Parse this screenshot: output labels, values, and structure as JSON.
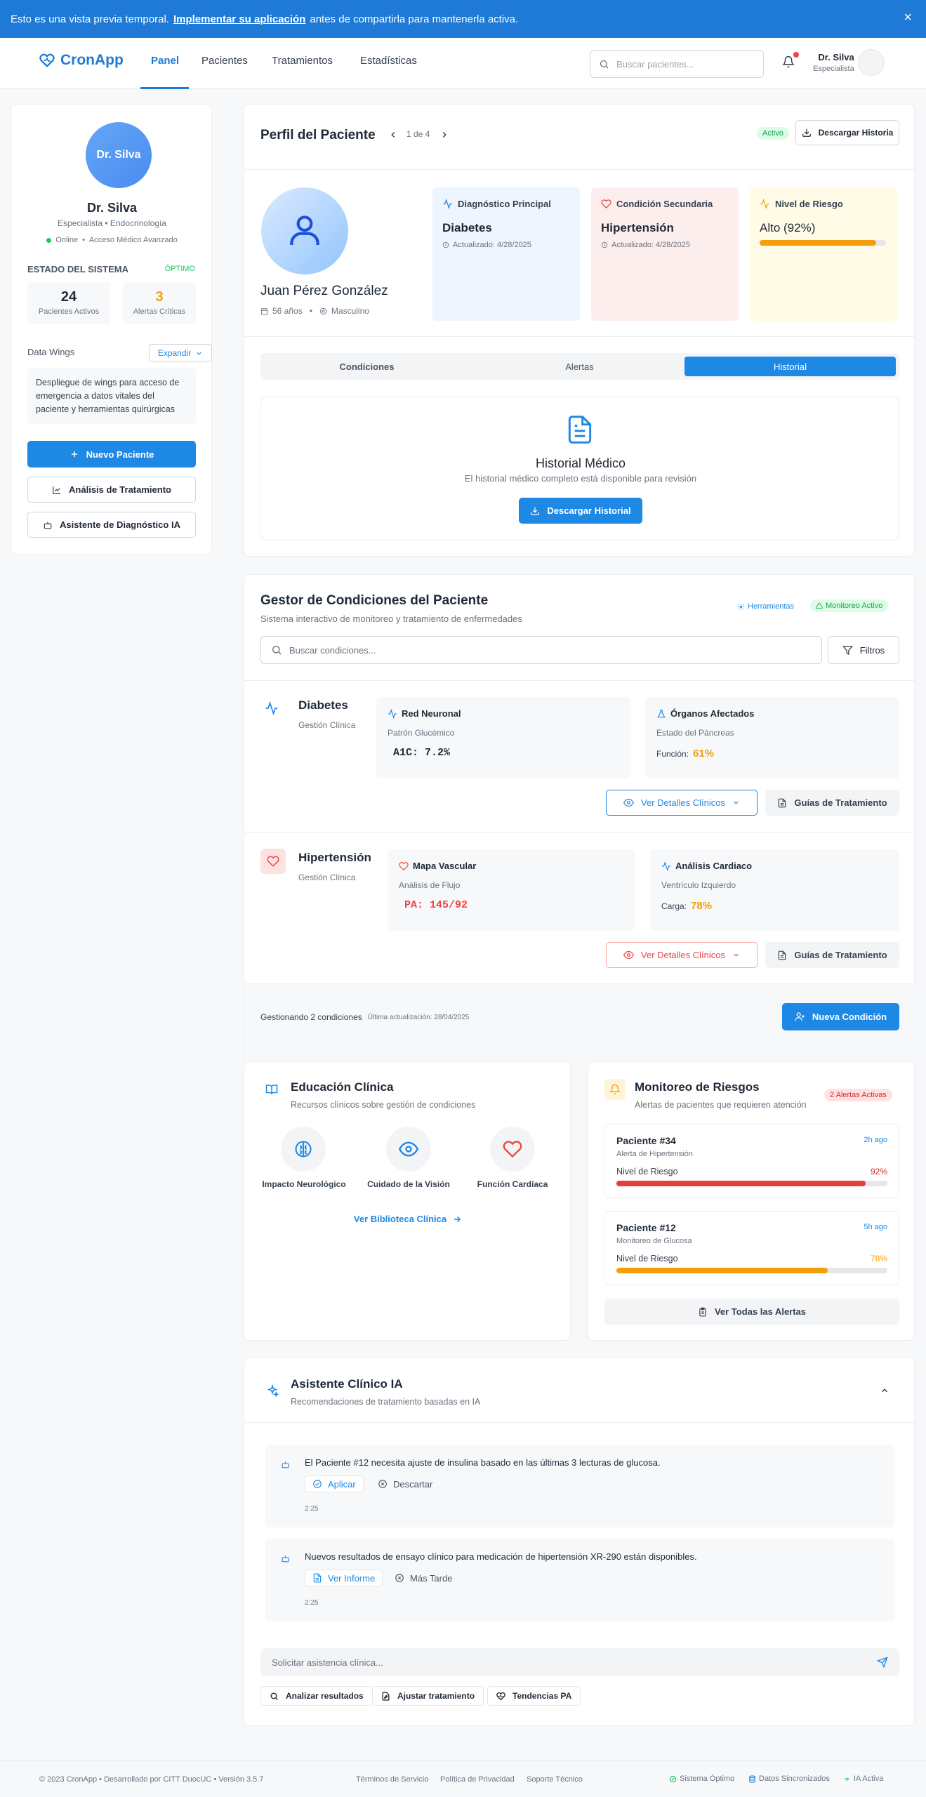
{
  "banner": {
    "text_before": "Esto es una vista previa temporal.",
    "link": "Implementar su aplicación",
    "text_after": "antes de compartirla para mantenerla activa.",
    "close": "×"
  },
  "nav": {
    "brand": "CronApp",
    "links": [
      "Panel",
      "Pacientes",
      "Tratamientos",
      "Estadísticas"
    ],
    "active": "Panel",
    "search_placeholder": "Buscar pacientes...",
    "user_name": "Dr. Silva",
    "user_role": "Especialista"
  },
  "sidebar": {
    "avatar_text": "Dr. Silva",
    "name": "Dr. Silva",
    "specialty": "Especialista • Endocrinología",
    "status": "Online",
    "access": "Acceso Médico Avanzado",
    "system_title": "ESTADO DEL SISTEMA",
    "system_state": "ÓPTIMO",
    "stats": [
      {
        "value": "24",
        "label": "Pacientes Activos",
        "color": "#1f2937"
      },
      {
        "value": "3",
        "label": "Alertas Críticas",
        "color": "#f59e0b"
      }
    ],
    "wings_title": "Data Wings",
    "expand": "Expandir",
    "wings_text": "Despliegue de wings para acceso de emergencia a datos vitales del paciente y herramientas quirúrgicas",
    "new_patient": "Nuevo Paciente",
    "analysis": "Análisis de Tratamiento",
    "assistant": "Asistente de Diagnóstico IA"
  },
  "profile": {
    "title": "Perfil del Paciente",
    "pager": "1 de 4",
    "status": "Activo",
    "download": "Descargar Historia",
    "name": "Juan Pérez González",
    "age": "56 años",
    "sex": "Masculino",
    "cards": [
      {
        "title": "Diagnóstico Principal",
        "value": "Diabetes",
        "sub": "Actualizado: 4/28/2025",
        "icon": "activity-icon",
        "bg": "#eef5ff",
        "color": "#1e88e5"
      },
      {
        "title": "Condición Secundaria",
        "value": "Hipertensión",
        "sub": "Actualizado: 4/28/2025",
        "icon": "heart-icon",
        "bg": "#fdeeee",
        "color": "#ef4444"
      },
      {
        "title": "Nivel de Riesgo",
        "value": "Alto (92%)",
        "risk": 0.92,
        "icon": "activity-icon",
        "bg": "#fffbe6",
        "color": "#f59e0b"
      }
    ],
    "tabs": [
      "Condiciones",
      "Alertas",
      "Historial"
    ],
    "active_tab": "Historial",
    "history_title": "Historial Médico",
    "history_sub": "El historial médico completo está disponible para revisión",
    "history_btn": "Descargar Historial"
  },
  "manager": {
    "title": "Gestor de Condiciones del Paciente",
    "sub": "Sistema interactivo de monitoreo y tratamiento de enfermedades",
    "tools": "Herramientas",
    "monitor": "Monitoreo Activo",
    "search_placeholder": "Buscar condiciones...",
    "filters": "Filtros",
    "conditions": [
      {
        "name": "Diabetes",
        "sub": "Gestión Clínica",
        "color": "#1e88e5",
        "p1_title": "Red Neuronal",
        "p1_label": "Patrón Glucémico",
        "p1_value": "A1C: 7.2%",
        "p1_color": "#1f2937",
        "p2_title": "Órganos Afectados",
        "p2_label": "Estado del Páncreas",
        "p2_key": "Función:",
        "p2_value": "61%",
        "details": "Ver Detalles Clínicos",
        "guides": "Guías de Tratamiento"
      },
      {
        "name": "Hipertensión",
        "sub": "Gestión Clínica",
        "color": "#ef4444",
        "p1_title": "Mapa Vascular",
        "p1_label": "Análisis de Flujo",
        "p1_value": "PA: 145/92",
        "p1_color": "#ef4444",
        "p2_title": "Análisis Cardiaco",
        "p2_label": "Ventrículo Izquierdo",
        "p2_key": "Carga:",
        "p2_value": "78%",
        "details": "Ver Detalles Clínicos",
        "guides": "Guías de Tratamiento"
      }
    ],
    "footer_count": "Gestionando 2 condiciones",
    "footer_update": "Última actualización: 28/04/2025",
    "new_condition": "Nueva Condición"
  },
  "education": {
    "title": "Educación Clínica",
    "sub": "Recursos clínicos sobre gestión de condiciones",
    "items": [
      "Impacto Neurológico",
      "Cuidado de la Visión",
      "Función Cardíaca"
    ],
    "link": "Ver Biblioteca Clínica"
  },
  "risk": {
    "title": "Monitoreo de Riesgos",
    "sub": "Alertas de pacientes que requieren atención",
    "badge": "2 Alertas Activas",
    "label": "Nivel de Riesgo",
    "items": [
      {
        "patient": "Paciente #34",
        "type": "Alerta de Hipertensión",
        "time": "2h ago",
        "value": "92%",
        "level": 0.92,
        "color": "#e53e3e"
      },
      {
        "patient": "Paciente #12",
        "type": "Monitoreo de Glucosa",
        "time": "5h ago",
        "value": "78%",
        "level": 0.78,
        "color": "#f59e0b"
      }
    ],
    "all": "Ver Todas las Alertas"
  },
  "assistant": {
    "title": "Asistente Clínico IA",
    "sub": "Recomendaciones de tratamiento basadas en IA",
    "messages": [
      {
        "text": "El Paciente #12 necesita ajuste de insulina basado en las últimas 3 lecturas de glucosa.",
        "a1": "Aplicar",
        "a2": "Descartar",
        "time": "2:25"
      },
      {
        "text": "Nuevos resultados de ensayo clínico para medicación de hipertensión XR-290 están disponibles.",
        "a1": "Ver Informe",
        "a2": "Más Tarde",
        "time": "2:25"
      }
    ],
    "input_placeholder": "Solicitar asistencia clínica...",
    "chips": [
      "Analizar resultados",
      "Ajustar tratamiento",
      "Tendencias PA"
    ]
  },
  "footer": {
    "copy": "© 2023 CronApp • Desarrollado por CITT DuocUC • Versión 3.5.7",
    "links": [
      "Términos de Servicio",
      "Política de Privacidad",
      "Soporte Técnico"
    ],
    "status": [
      "Sistema Óptimo",
      "Datos Sincronizados",
      "IA Activa"
    ]
  }
}
